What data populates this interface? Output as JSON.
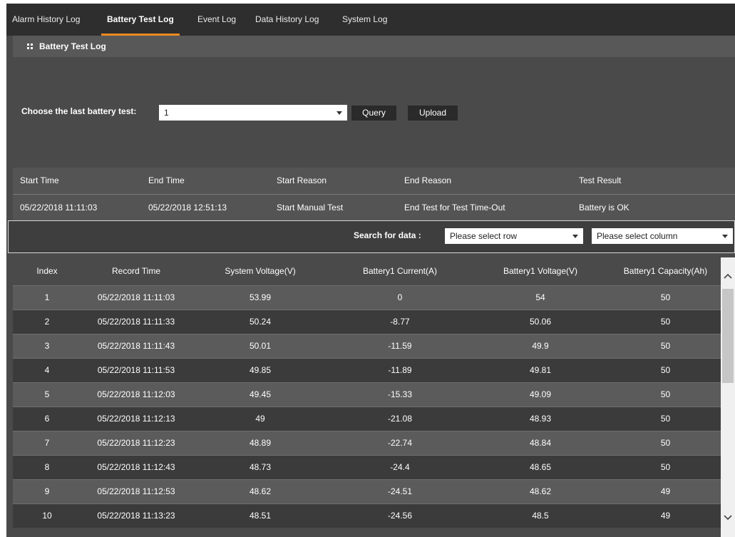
{
  "tabs": [
    {
      "label": "Alarm History Log",
      "active": false
    },
    {
      "label": "Battery Test Log",
      "active": true
    },
    {
      "label": "Event Log",
      "active": false
    },
    {
      "label": "Data History Log",
      "active": false
    },
    {
      "label": "System Log",
      "active": false
    }
  ],
  "section": {
    "title": "Battery Test Log",
    "icon": "grid-icon"
  },
  "query": {
    "label": "Choose the last battery test:",
    "selected": "1",
    "query_button": "Query",
    "upload_button": "Upload"
  },
  "summary": {
    "headers": [
      "Start Time",
      "End Time",
      "Start Reason",
      "End Reason",
      "Test Result"
    ],
    "values": [
      "05/22/2018 11:11:03",
      "05/22/2018 12:51:13",
      "Start Manual Test",
      "End Test for Test Time-Out",
      "Battery is OK"
    ]
  },
  "search": {
    "label": "Search for data :",
    "row_select": "Please select row",
    "column_select": "Please select column"
  },
  "table": {
    "columns": [
      "Index",
      "Record Time",
      "System Voltage(V)",
      "Battery1 Current(A)",
      "Battery1 Voltage(V)",
      "Battery1 Capacity(Ah)"
    ],
    "rows": [
      [
        "1",
        "05/22/2018 11:11:03",
        "53.99",
        "0",
        "54",
        "50"
      ],
      [
        "2",
        "05/22/2018 11:11:33",
        "50.24",
        "-8.77",
        "50.06",
        "50"
      ],
      [
        "3",
        "05/22/2018 11:11:43",
        "50.01",
        "-11.59",
        "49.9",
        "50"
      ],
      [
        "4",
        "05/22/2018 11:11:53",
        "49.85",
        "-11.89",
        "49.81",
        "50"
      ],
      [
        "5",
        "05/22/2018 11:12:03",
        "49.45",
        "-15.33",
        "49.09",
        "50"
      ],
      [
        "6",
        "05/22/2018 11:12:13",
        "49",
        "-21.08",
        "48.93",
        "50"
      ],
      [
        "7",
        "05/22/2018 11:12:23",
        "48.89",
        "-22.74",
        "48.84",
        "50"
      ],
      [
        "8",
        "05/22/2018 11:12:43",
        "48.73",
        "-24.4",
        "48.65",
        "50"
      ],
      [
        "9",
        "05/22/2018 11:12:53",
        "48.62",
        "-24.51",
        "48.62",
        "49"
      ],
      [
        "10",
        "05/22/2018 11:13:23",
        "48.51",
        "-24.56",
        "48.5",
        "49"
      ]
    ]
  },
  "colors": {
    "accent": "#ef8a22",
    "tabbar": "#2e2e2e",
    "panel": "#4a4a4a",
    "row_light": "#5b5b5b",
    "row_dark": "#3b3b3b"
  }
}
